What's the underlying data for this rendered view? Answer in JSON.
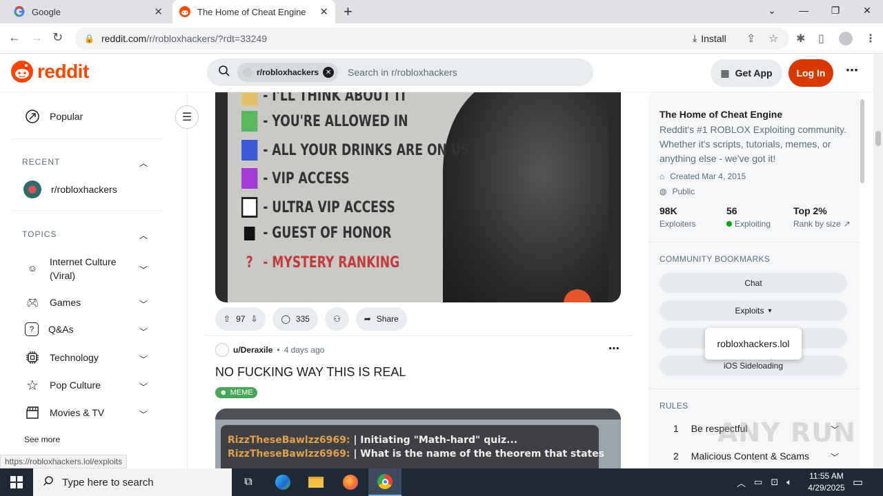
{
  "browser": {
    "tabs": [
      {
        "title": "Google",
        "active": false
      },
      {
        "title": "The Home of Cheat Engine",
        "active": true
      }
    ],
    "url_host": "reddit.com",
    "url_path": "/r/robloxhackers/?rdt=33249",
    "install_label": "Install",
    "status_url": "https://robloxhackers.lol/exploits"
  },
  "header": {
    "logo_text": "reddit",
    "search_chip": "r/robloxhackers",
    "search_placeholder": "Search in r/robloxhackers",
    "get_app": "Get App",
    "login": "Log In"
  },
  "leftnav": {
    "popular": "Popular",
    "recent_heading": "RECENT",
    "recent_item": "r/robloxhackers",
    "topics_heading": "TOPICS",
    "topics": [
      {
        "label": "Internet Culture",
        "label2": "(Viral)",
        "icon": "smile-icon"
      },
      {
        "label": "Games",
        "icon": "gamepad-icon"
      },
      {
        "label": "Q&As",
        "icon": "question-icon"
      },
      {
        "label": "Technology",
        "icon": "chip-icon"
      },
      {
        "label": "Pop Culture",
        "icon": "star-icon"
      },
      {
        "label": "Movies & TV",
        "icon": "clapper-icon"
      }
    ],
    "see_more": "See more"
  },
  "post1": {
    "image_text": [
      {
        "text": "- I'LL THINK ABOUT IT",
        "color": "#e3c26a"
      },
      {
        "text": "- YOU'RE ALLOWED IN",
        "color": "#5cb85c"
      },
      {
        "text": "- ALL YOUR DRINKS ARE ON US",
        "color": "#3b5bd6"
      },
      {
        "text": "- VIP ACCESS",
        "color": "#a43bd6"
      },
      {
        "text": "- ULTRA VIP ACCESS",
        "color": "#ffffff"
      },
      {
        "text": "- GUEST OF HONOR",
        "color": "#111111"
      },
      {
        "text": "- MYSTERY RANKING",
        "color": "?"
      }
    ],
    "votes": "97",
    "comments": "335",
    "share": "Share"
  },
  "post2": {
    "user": "u/Deraxile",
    "time": "4 days ago",
    "title": "NO FUCKING WAY THIS IS REAL",
    "flair": "MEME",
    "chat": [
      {
        "who": "RizzTheseBawlzz6969:",
        "msg": "| Initiating \"Math-hard\" quiz..."
      },
      {
        "who": "RizzTheseBawlzz6969:",
        "msg": "| What is the name of the theorem that states"
      }
    ]
  },
  "sidebar": {
    "title": "The Home of Cheat Engine",
    "description": "Reddit's #1 ROBLOX Exploiting community. Whether it's scripts, tutorials, memes, or anything else - we've got it!",
    "created": "Created Mar 4, 2015",
    "visibility": "Public",
    "stats": [
      {
        "value": "98K",
        "label": "Exploiters"
      },
      {
        "value": "56",
        "label": "Exploiting"
      },
      {
        "value": "Top 2%",
        "label": "Rank by size"
      }
    ],
    "bookmarks_heading": "COMMUNITY BOOKMARKS",
    "bookmarks": [
      "Chat",
      "Exploits",
      "",
      "iOS Sideloading"
    ],
    "dropdown_item": "robloxhackers.lol",
    "rules_heading": "RULES",
    "rules": [
      {
        "num": "1",
        "text": "Be respectful"
      },
      {
        "num": "2",
        "text": "Malicious Content & Scams"
      }
    ]
  },
  "watermark": "ANY RUN",
  "taskbar": {
    "search_placeholder": "Type here to search",
    "time": "11:55 AM",
    "date": "4/29/2025"
  }
}
